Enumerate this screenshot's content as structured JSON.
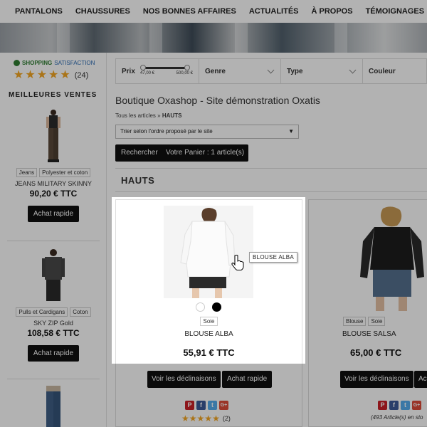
{
  "nav": {
    "items": [
      "PANTALONS",
      "CHAUSSURES",
      "NOS BONNES AFFAIRES",
      "ACTUALITÉS",
      "À PROPOS",
      "TÉMOIGNAGES"
    ]
  },
  "sidebar": {
    "shopping_satisfaction": {
      "brand": "SHOPPING",
      "sub": "SATISFACTION",
      "rating": 5,
      "count": "(24)"
    },
    "best_title": "MEILLEURES VENTES",
    "products": [
      {
        "tags": [
          "Jeans",
          "Polyester et coton"
        ],
        "name": "JEANS MILITARY SKINNY",
        "price": "90,20 € TTC",
        "button": "Achat rapide"
      },
      {
        "tags": [
          "Pulls et Cardigans",
          "Coton"
        ],
        "name": "SKY ZIP Gold",
        "price": "108,58 € TTC",
        "button": "Achat rapide"
      }
    ]
  },
  "filters": {
    "price_label": "Prix",
    "price_min": "47,00 €",
    "price_max": "500,00 €",
    "genre": "Genre",
    "type": "Type",
    "couleur": "Couleur"
  },
  "main": {
    "title": "Boutique Oxashop - Site démonstration Oxatis",
    "breadcrumb_root": "Tous les articles",
    "breadcrumb_sep": "»",
    "breadcrumb_current": "HAUTS",
    "sort_value": "Trier selon l'ordre proposé par le site",
    "search_button": "Rechercher",
    "cart_button": "Votre Panier : 1 article(s)",
    "category": "HAUTS"
  },
  "products": [
    {
      "name": "BLOUSE ALBA",
      "price": "55,91 € TTC",
      "tags": [
        "Soie"
      ],
      "tooltip": "BLOUSE  ALBA",
      "btn_variants": "Voir les déclinaisons",
      "btn_quick": "Achat rapide",
      "rating": 5,
      "review_count": "(2)"
    },
    {
      "name": "BLOUSE SALSA",
      "price": "65,00 € TTC",
      "tags": [
        "Blouse",
        "Soie"
      ],
      "btn_variants": "Voir les déclinaisons",
      "btn_quick": "Ac",
      "stock": "(493 Article(s) en sto"
    }
  ],
  "colors": {
    "accent": "#111111",
    "star": "#f4a623",
    "pinterest": "#cb2027",
    "facebook": "#3b5998",
    "twitter": "#55acee",
    "gplus": "#dd4b39"
  }
}
